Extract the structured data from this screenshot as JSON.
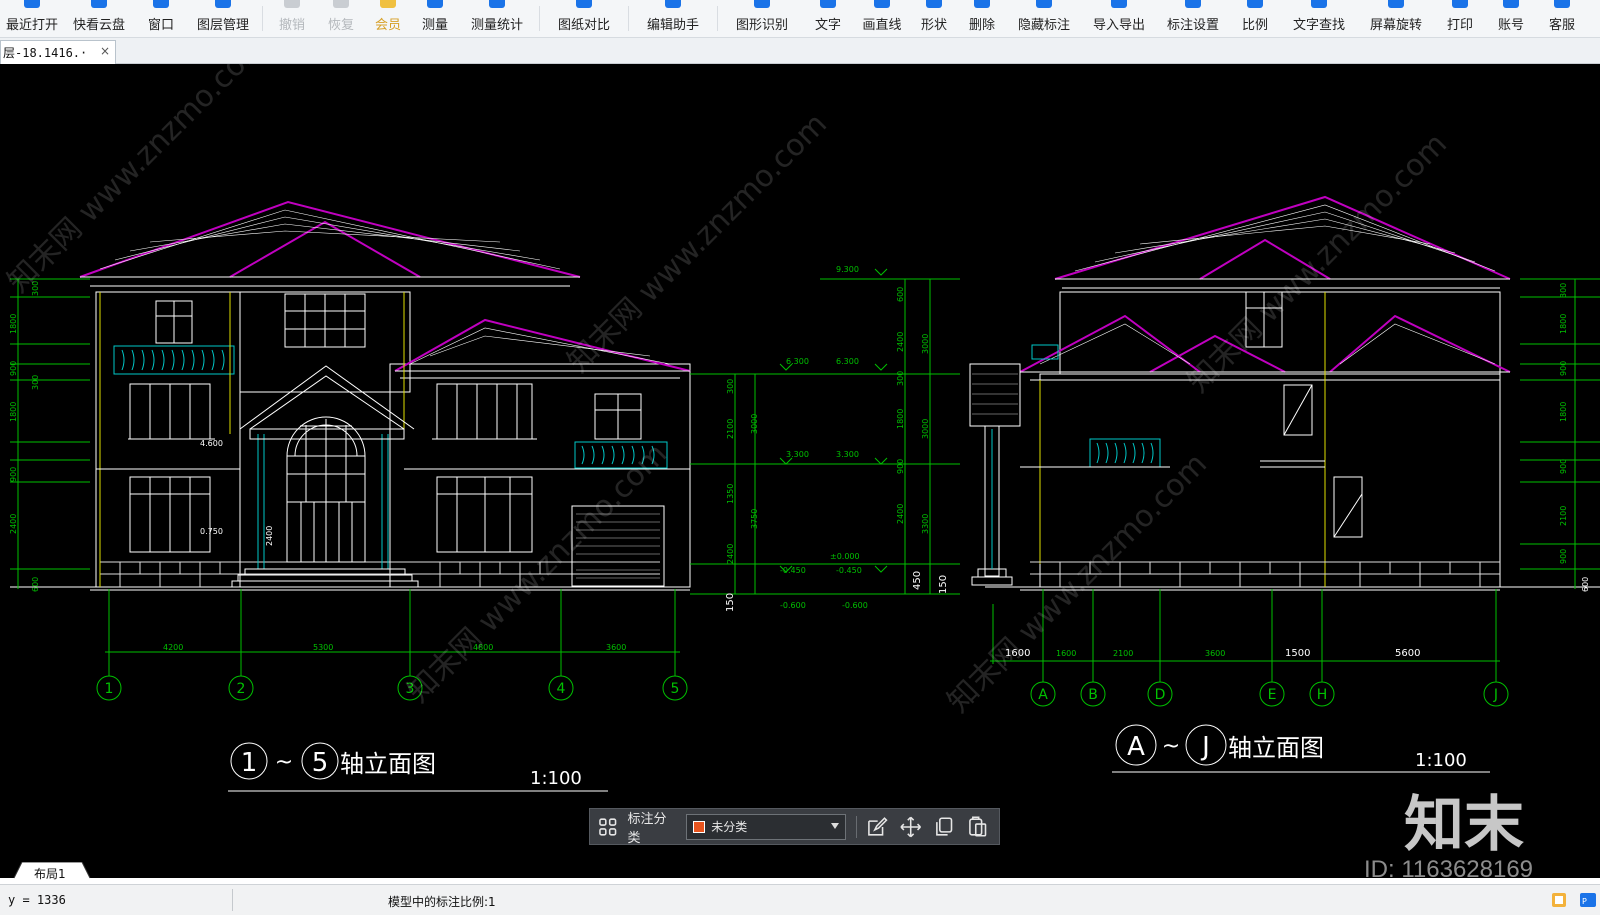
{
  "toolbar": {
    "items": [
      {
        "label": "最近打开",
        "icon": "recent-open-icon",
        "state": "normal"
      },
      {
        "label": "快看云盘",
        "icon": "cloud-disk-icon",
        "state": "normal"
      },
      {
        "label": "窗口",
        "icon": "window-icon",
        "state": "normal"
      },
      {
        "label": "图层管理",
        "icon": "layers-icon",
        "state": "normal"
      },
      {
        "label": "撤销",
        "icon": "undo-icon",
        "state": "disabled"
      },
      {
        "label": "恢复",
        "icon": "redo-icon",
        "state": "disabled"
      },
      {
        "label": "会员",
        "icon": "vip-icon",
        "state": "vip"
      },
      {
        "label": "测量",
        "icon": "ruler-icon",
        "state": "normal"
      },
      {
        "label": "测量统计",
        "icon": "measure-stats-icon",
        "state": "normal"
      },
      {
        "label": "图纸对比",
        "icon": "compare-icon",
        "state": "normal"
      },
      {
        "label": "编辑助手",
        "icon": "edit-assistant-icon",
        "state": "normal"
      },
      {
        "label": "图形识别",
        "icon": "shape-recognition-icon",
        "state": "normal"
      },
      {
        "label": "文字",
        "icon": "text-icon",
        "state": "normal"
      },
      {
        "label": "画直线",
        "icon": "line-icon",
        "state": "normal"
      },
      {
        "label": "形状",
        "icon": "shape-icon",
        "state": "normal"
      },
      {
        "label": "删除",
        "icon": "eraser-icon",
        "state": "normal"
      },
      {
        "label": "隐藏标注",
        "icon": "hide-annotation-icon",
        "state": "normal"
      },
      {
        "label": "导入导出",
        "icon": "import-export-icon",
        "state": "normal"
      },
      {
        "label": "标注设置",
        "icon": "annotation-settings-icon",
        "state": "normal"
      },
      {
        "label": "比例",
        "icon": "scale-icon",
        "state": "normal"
      },
      {
        "label": "文字查找",
        "icon": "text-search-icon",
        "state": "normal"
      },
      {
        "label": "屏幕旋转",
        "icon": "rotate-screen-icon",
        "state": "normal"
      },
      {
        "label": "打印",
        "icon": "print-icon",
        "state": "normal"
      },
      {
        "label": "账号",
        "icon": "account-icon",
        "state": "normal"
      },
      {
        "label": "客服",
        "icon": "customer-service-icon",
        "state": "normal"
      }
    ]
  },
  "document_tab": {
    "title": "层-18.1416.·",
    "close_glyph": "×"
  },
  "drawing": {
    "left_view": {
      "title_text": "轴立面图",
      "axis_start": "1",
      "axis_end": "5",
      "tilde": "~",
      "scale": "1:100",
      "axis_labels": [
        "1",
        "2",
        "3",
        "4",
        "5"
      ],
      "axis_dims": [
        "4200",
        "5300",
        "4800",
        "3600"
      ],
      "left_dims": [
        "300",
        "1800",
        "900",
        "300",
        "1800",
        "300",
        "900",
        "2400",
        "600"
      ],
      "inner_dims": [
        "4.600",
        "0.750",
        "2400"
      ]
    },
    "right_view": {
      "title_text": "轴立面图",
      "axis_start": "A",
      "axis_end": "J",
      "tilde": "~",
      "scale": "1:100",
      "axis_labels": [
        "A",
        "B",
        "D",
        "E",
        "H",
        "J"
      ],
      "axis_dims": [
        "1600",
        "1600",
        "2100",
        "3600",
        "1500",
        "5600"
      ],
      "right_dims": [
        "300",
        "1800",
        "900",
        "300",
        "1800",
        "300",
        "900",
        "2100",
        "900",
        "600"
      ]
    },
    "middle_dims": {
      "levels_left": [
        "9.300",
        "6.300",
        "3.300",
        "-0.450",
        "-0.600"
      ],
      "levels_right": [
        "6.300",
        "3.300",
        "±0.000",
        "-0.450",
        "-0.600"
      ],
      "vert_left": [
        "300",
        "2100",
        "3000",
        "1350",
        "3750",
        "2400",
        "150"
      ],
      "vert_right": [
        "600",
        "3000",
        "2400",
        "300",
        "3000",
        "1800",
        "900",
        "3300",
        "2400",
        "450",
        "150"
      ]
    },
    "watermarks": [
      "知末网 www.znzmo.com",
      "知末网 www.znzmo.com",
      "知末网 www.znzmo.com",
      "知末网 www.znzmo.com",
      "知末网 www.znzmo.com"
    ]
  },
  "annotation_toolbar": {
    "label": "标注分类",
    "selected": "未分类",
    "swatch_color": "#e8541e",
    "icons": [
      "edit-icon",
      "move-icon",
      "copy-icon",
      "paste-icon"
    ]
  },
  "layout_tab": {
    "label": "布局1"
  },
  "statusbar": {
    "coordinate": "y = 1336",
    "scale_text": "模型中的标注比例:1"
  },
  "brand_watermark": {
    "text": "知末",
    "id": "ID: 1163628169"
  },
  "colors": {
    "roof": "#c000c0",
    "lines": "#ffffff",
    "dims": "#00c000",
    "cyan": "#00c8c8",
    "yellow": "#e0e000",
    "accent": "#1a73e8"
  }
}
